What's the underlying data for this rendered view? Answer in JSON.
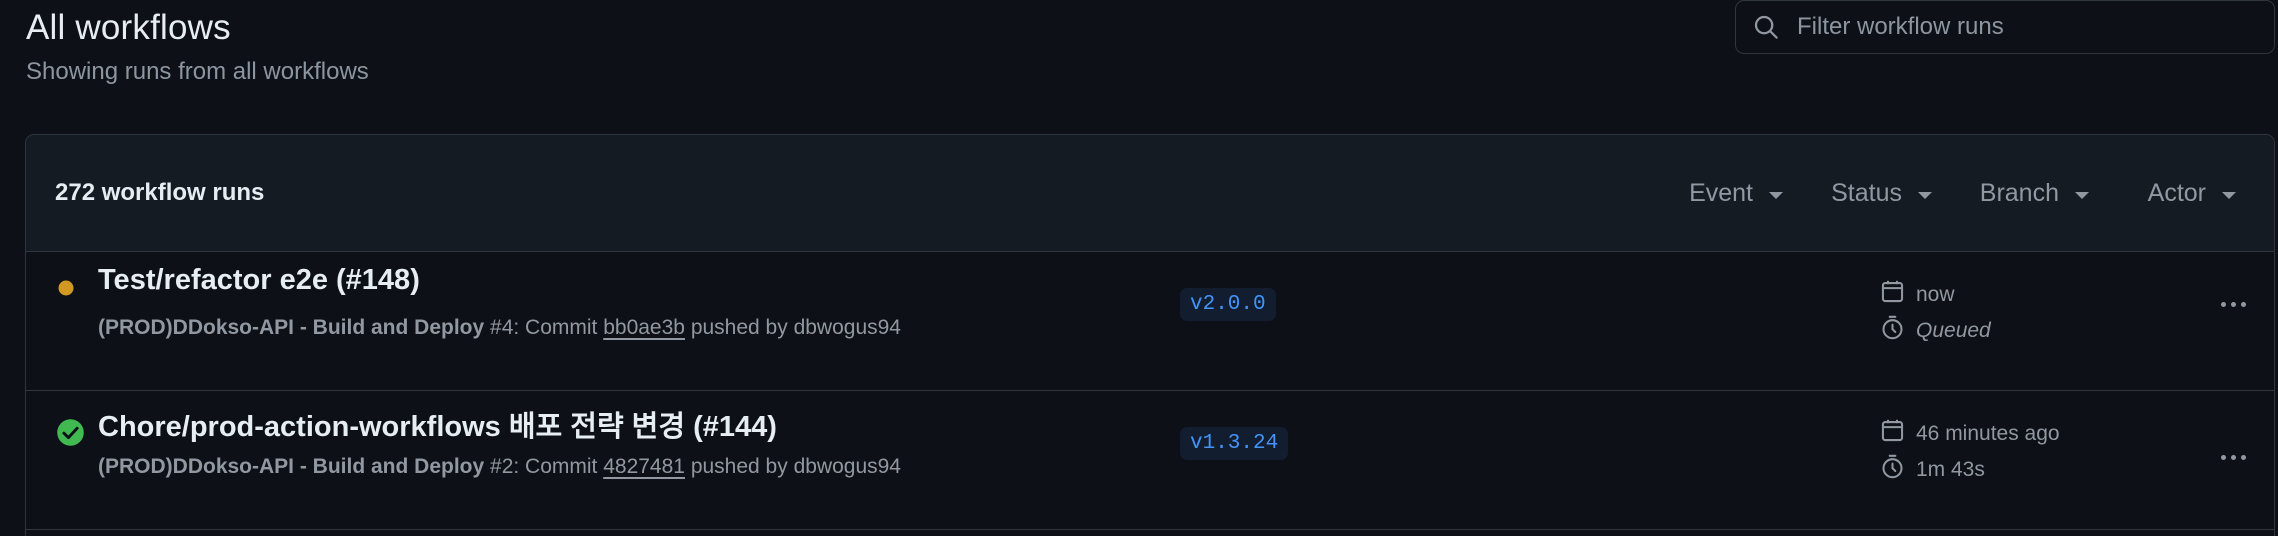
{
  "header": {
    "title": "All workflows",
    "subtitle": "Showing runs from all workflows"
  },
  "search": {
    "placeholder": "Filter workflow runs",
    "icon": "search-icon"
  },
  "runs_box": {
    "count_label": "272 workflow runs",
    "filters": [
      {
        "label": "Event"
      },
      {
        "label": "Status"
      },
      {
        "label": "Branch"
      },
      {
        "label": "Actor"
      }
    ]
  },
  "runs": [
    {
      "status": "queued",
      "status_color": "#d29922",
      "title": "Test/refactor e2e (#148)",
      "workflow": "(PROD)DDokso-API - Build and Deploy",
      "run_number": " #4: Commit ",
      "commit": "bb0ae3b",
      "pushed_by": " pushed by dbwogus94",
      "branch": "v2.0.0",
      "date": "now",
      "duration": "Queued"
    },
    {
      "status": "success",
      "status_color": "#3fb950",
      "title": "Chore/prod-action-workflows 배포 전략 변경 (#144)",
      "workflow": "(PROD)DDokso-API - Build and Deploy",
      "run_number": " #2: Commit ",
      "commit": "4827481",
      "pushed_by": " pushed by dbwogus94",
      "branch": "v1.3.24",
      "date": "46 minutes ago",
      "duration": "1m 43s"
    }
  ],
  "colors": {
    "background": "#0d1117",
    "header_bg": "#151b23",
    "border": "#30363d",
    "muted_text": "#9198a1",
    "link_blue": "#4493f8"
  }
}
